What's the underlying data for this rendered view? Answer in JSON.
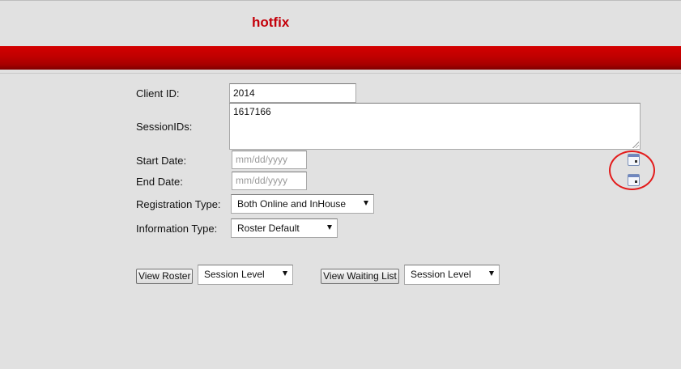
{
  "header": {
    "title": "hotfix",
    "accent_color": "#c4000a",
    "band_color": "#c00000"
  },
  "form": {
    "client_id": {
      "label": "Client ID:",
      "value": "2014"
    },
    "session_ids": {
      "label": "SessionIDs:",
      "value": "1617166"
    },
    "start_date": {
      "label": "Start Date:",
      "placeholder": "mm/dd/yyyy",
      "calendar_icon": "calendar-icon"
    },
    "end_date": {
      "label": "End Date:",
      "placeholder": "mm/dd/yyyy",
      "calendar_icon": "calendar-icon"
    },
    "registration_type": {
      "label": "Registration Type:",
      "selected": "Both Online and InHouse"
    },
    "information_type": {
      "label": "Information Type:",
      "selected": "Roster Default"
    }
  },
  "actions": {
    "view_roster": {
      "label": "View Roster",
      "level_selected": "Session Level"
    },
    "view_waiting_list": {
      "label": "View Waiting List",
      "level_selected": "Session Level"
    }
  },
  "annotation": {
    "color": "#e31b1b"
  }
}
